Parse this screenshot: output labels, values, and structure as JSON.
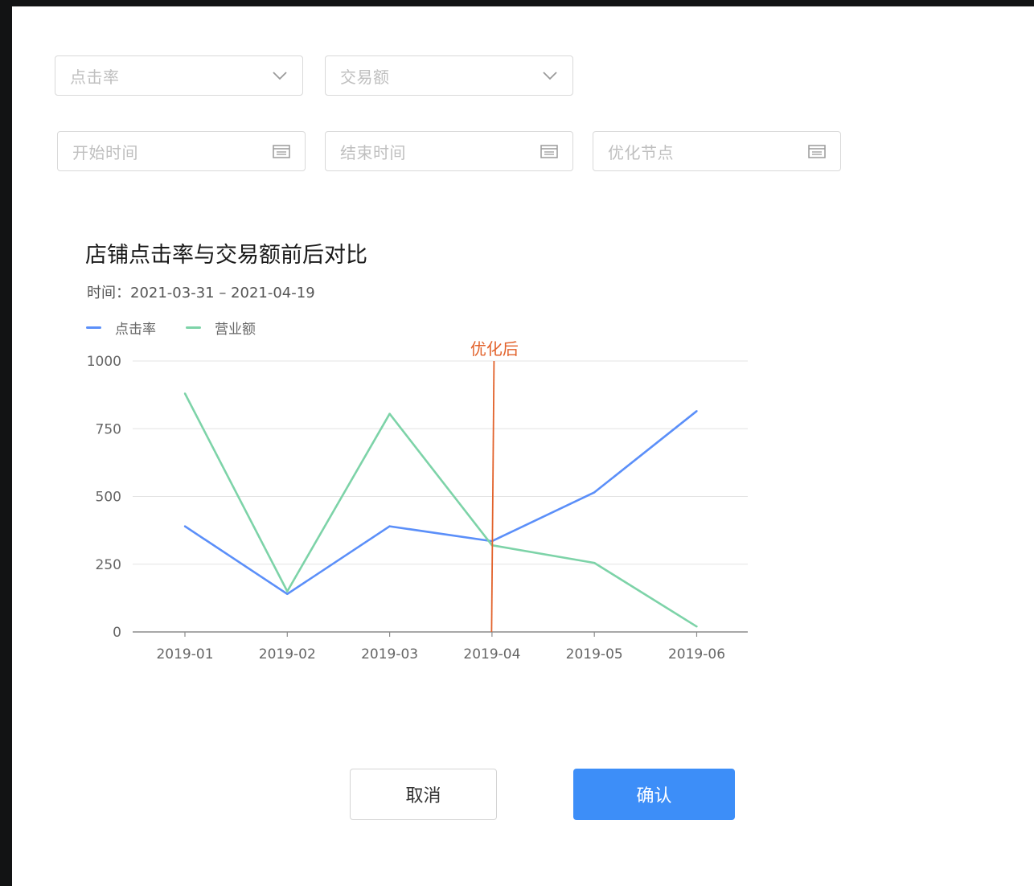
{
  "filters": {
    "metric_a": "点击率",
    "metric_b": "交易额",
    "start_time": "开始时间",
    "end_time": "结束时间",
    "opt_node": "优化节点"
  },
  "chart_data": {
    "type": "line",
    "title": "店铺点击率与交易额前后对比",
    "subtitle": "时间：2021-03-31  – 2021-04-19",
    "categories": [
      "2019-01",
      "2019-02",
      "2019-03",
      "2019-04",
      "2019-05",
      "2019-06"
    ],
    "ylim": [
      0,
      1000
    ],
    "yticks": [
      0,
      250,
      500,
      750,
      1000
    ],
    "grid": true,
    "legend_position": "top-left",
    "series": [
      {
        "name": "点击率",
        "color": "#5b8ff9",
        "values": [
          390,
          140,
          390,
          335,
          515,
          815
        ]
      },
      {
        "name": "营业额",
        "color": "#7dd3a8",
        "values": [
          880,
          150,
          805,
          320,
          255,
          20
        ]
      }
    ],
    "annotation": {
      "label": "优化后",
      "category": "2019-04",
      "color": "#e2622b"
    }
  },
  "buttons": {
    "cancel": "取消",
    "confirm": "确认"
  }
}
